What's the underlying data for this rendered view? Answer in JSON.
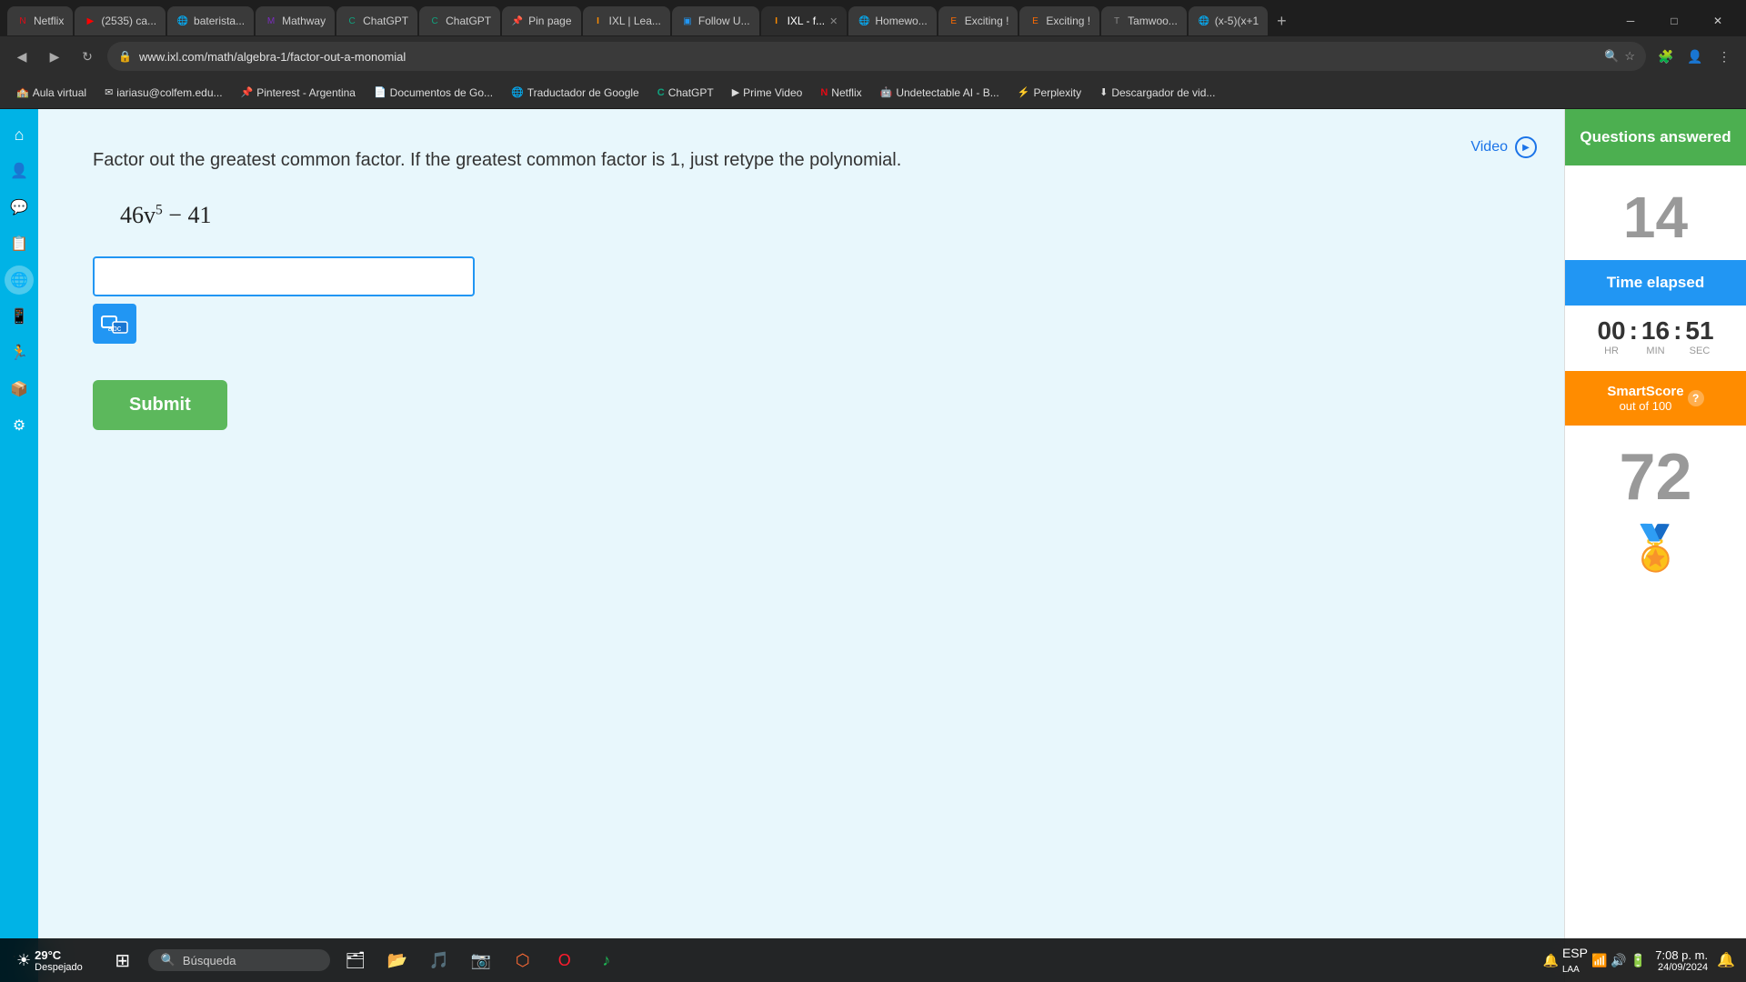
{
  "browser": {
    "tabs": [
      {
        "label": "Netflix",
        "favicon": "N",
        "active": false,
        "fav_color": "#e50914"
      },
      {
        "label": "(2535) ca...",
        "favicon": "▶",
        "active": false,
        "fav_color": "#ff0000"
      },
      {
        "label": "baterista...",
        "favicon": "🌐",
        "active": false,
        "fav_color": "#4285f4"
      },
      {
        "label": "Mathway",
        "favicon": "M",
        "active": false,
        "fav_color": "#7b2cbf"
      },
      {
        "label": "ChatGPT",
        "favicon": "C",
        "active": false,
        "fav_color": "#10a37f"
      },
      {
        "label": "ChatGPT",
        "favicon": "C",
        "active": false,
        "fav_color": "#10a37f"
      },
      {
        "label": "Pin page",
        "favicon": "📌",
        "active": false,
        "fav_color": "#e60023"
      },
      {
        "label": "IXL | Lea...",
        "favicon": "I",
        "active": false,
        "fav_color": "#ff8c00"
      },
      {
        "label": "Follow U...",
        "favicon": "🟦",
        "active": false,
        "fav_color": "#2196f3"
      },
      {
        "label": "IXL - f...",
        "favicon": "I",
        "active": true,
        "fav_color": "#ff8c00"
      },
      {
        "label": "Homewo...",
        "favicon": "🌐",
        "active": false,
        "fav_color": "#4285f4"
      },
      {
        "label": "Exciting ...",
        "favicon": "E",
        "active": false,
        "fav_color": "#ff6b00"
      },
      {
        "label": "Exciting ...",
        "favicon": "E",
        "active": false,
        "fav_color": "#ff6b00"
      },
      {
        "label": "Tamwoo...",
        "favicon": "T",
        "active": false,
        "fav_color": "#888"
      },
      {
        "label": "(x-5)(x+1",
        "favicon": "🌐",
        "active": false,
        "fav_color": "#4285f4"
      }
    ],
    "address": "www.ixl.com/math/algebra-1/factor-out-a-monomial",
    "window_controls": [
      "─",
      "□",
      "✕"
    ]
  },
  "bookmarks": [
    {
      "label": "Aula virtual",
      "icon": "🏫"
    },
    {
      "label": "iariasu@colfem.edu...",
      "icon": "✉"
    },
    {
      "label": "Pinterest - Argentina",
      "icon": "📌"
    },
    {
      "label": "Documentos de Go...",
      "icon": "📄"
    },
    {
      "label": "Traductador de Google",
      "icon": "🌐"
    },
    {
      "label": "ChatGPT",
      "icon": "C"
    },
    {
      "label": "Prime Video",
      "icon": "▶"
    },
    {
      "label": "Netflix",
      "icon": "N"
    },
    {
      "label": "Undetectable AI - B...",
      "icon": "🤖"
    },
    {
      "label": "Perplexity",
      "icon": "P"
    },
    {
      "label": "Descargador de vid...",
      "icon": "⬇"
    }
  ],
  "sidebar": {
    "icons": [
      "🏠",
      "👤",
      "💬",
      "📋",
      "🌐",
      "🔔",
      "🏃",
      "📦",
      "⚙"
    ]
  },
  "question": {
    "instruction": "Factor out the greatest common factor. If the greatest common factor is 1, just retype the polynomial.",
    "expression": "46v⁵ − 41",
    "expression_base": "46v",
    "expression_exp": "5",
    "expression_rest": " − 41",
    "video_label": "Video",
    "submit_label": "Submit",
    "input_placeholder": ""
  },
  "right_panel": {
    "questions_answered_label": "Questions answered",
    "questions_count": "14",
    "time_elapsed_label": "Time elapsed",
    "timer": {
      "hours": "00",
      "minutes": "16",
      "seconds": "51",
      "hr_label": "HR",
      "min_label": "MIN",
      "sec_label": "SEC"
    },
    "smartscore_label": "SmartScore",
    "smartscore_sublabel": "out of 100",
    "smartscore_value": "72",
    "accent_green": "#4caf50",
    "accent_blue": "#2196f3",
    "accent_orange": "#ff8c00"
  },
  "taskbar": {
    "weather_temp": "29°C",
    "weather_condition": "Despejado",
    "search_placeholder": "Búsqueda",
    "time": "7:08 p. m.",
    "date": "24/09/2024",
    "language": "ESP",
    "language_sub": "LAA"
  }
}
